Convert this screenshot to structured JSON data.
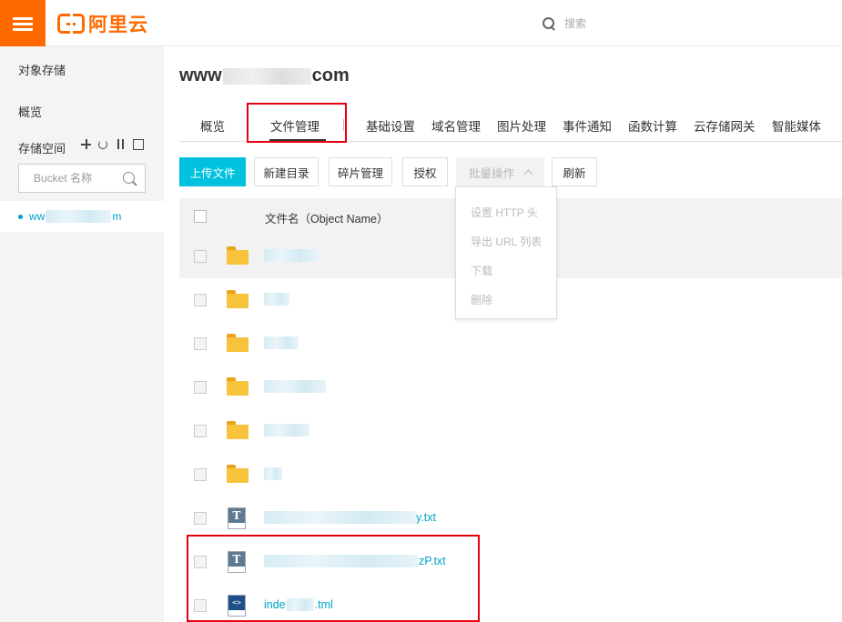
{
  "header": {
    "logo_text": "阿里云",
    "search_placeholder": "搜索",
    "brand_color": "#ff6a00"
  },
  "sidebar": {
    "title": "对象存储",
    "overview": "概览",
    "storage_space": "存储空间",
    "bucket_search_placeholder": "Bucket 名称",
    "selected_bucket_prefix": "ww",
    "selected_bucket_suffix": "m",
    "accent_color": "#00a2ca"
  },
  "main": {
    "bucket_title_prefix": "www",
    "bucket_title_suffix": "com",
    "tabs": [
      {
        "label": "概览"
      },
      {
        "label": "文件管理"
      },
      {
        "label": "基础设置"
      },
      {
        "label": "域名管理"
      },
      {
        "label": "图片处理"
      },
      {
        "label": "事件通知"
      },
      {
        "label": "函数计算"
      },
      {
        "label": "云存储网关"
      },
      {
        "label": "智能媒体"
      }
    ],
    "toolbar": {
      "upload": "上传文件",
      "new_dir": "新建目录",
      "fragments": "碎片管理",
      "authorize": "授权",
      "batch": "批量操作",
      "refresh": "刷新"
    },
    "batch_menu": [
      "设置 HTTP 头",
      "导出 URL 列表",
      "下载",
      "删除"
    ],
    "table": {
      "column_name": "文件名（Object Name）",
      "rows": [
        {
          "type": "folder",
          "name_suffix": ""
        },
        {
          "type": "folder",
          "name_suffix": ""
        },
        {
          "type": "folder",
          "name_suffix": ""
        },
        {
          "type": "folder",
          "name_suffix": ""
        },
        {
          "type": "folder",
          "name_suffix": ""
        },
        {
          "type": "folder",
          "name_suffix": ""
        },
        {
          "type": "txt",
          "icon_letter": "T",
          "name_prefix": "",
          "name_suffix": "y.txt"
        },
        {
          "type": "txt",
          "icon_letter": "T",
          "name_prefix": "",
          "name_suffix": "zP.txt"
        },
        {
          "type": "html",
          "icon_letter": "<>",
          "name_prefix": "inde",
          "name_suffix": ".tml"
        }
      ]
    }
  }
}
